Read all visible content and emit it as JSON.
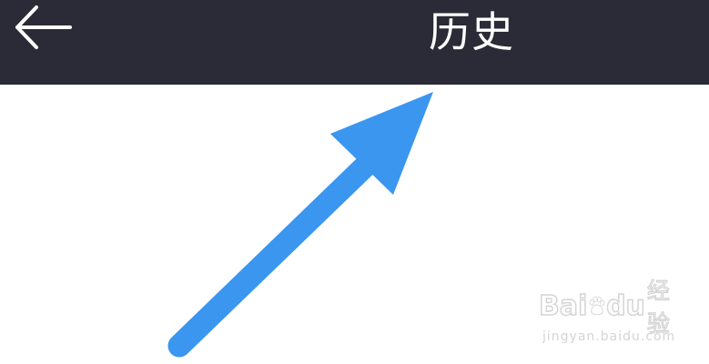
{
  "header": {
    "title": "历史",
    "back_icon": "arrow-left-icon",
    "background_color": "#2a2b36",
    "text_color": "#ffffff"
  },
  "annotation": {
    "icon": "arrow-up-right-icon",
    "color": "#3a96ef"
  },
  "watermark": {
    "logo_text_1": "Bai",
    "logo_text_2": "du",
    "logo_icon": "paw-icon",
    "logo_suffix": "经验",
    "url": "jingyan.baidu.com"
  }
}
